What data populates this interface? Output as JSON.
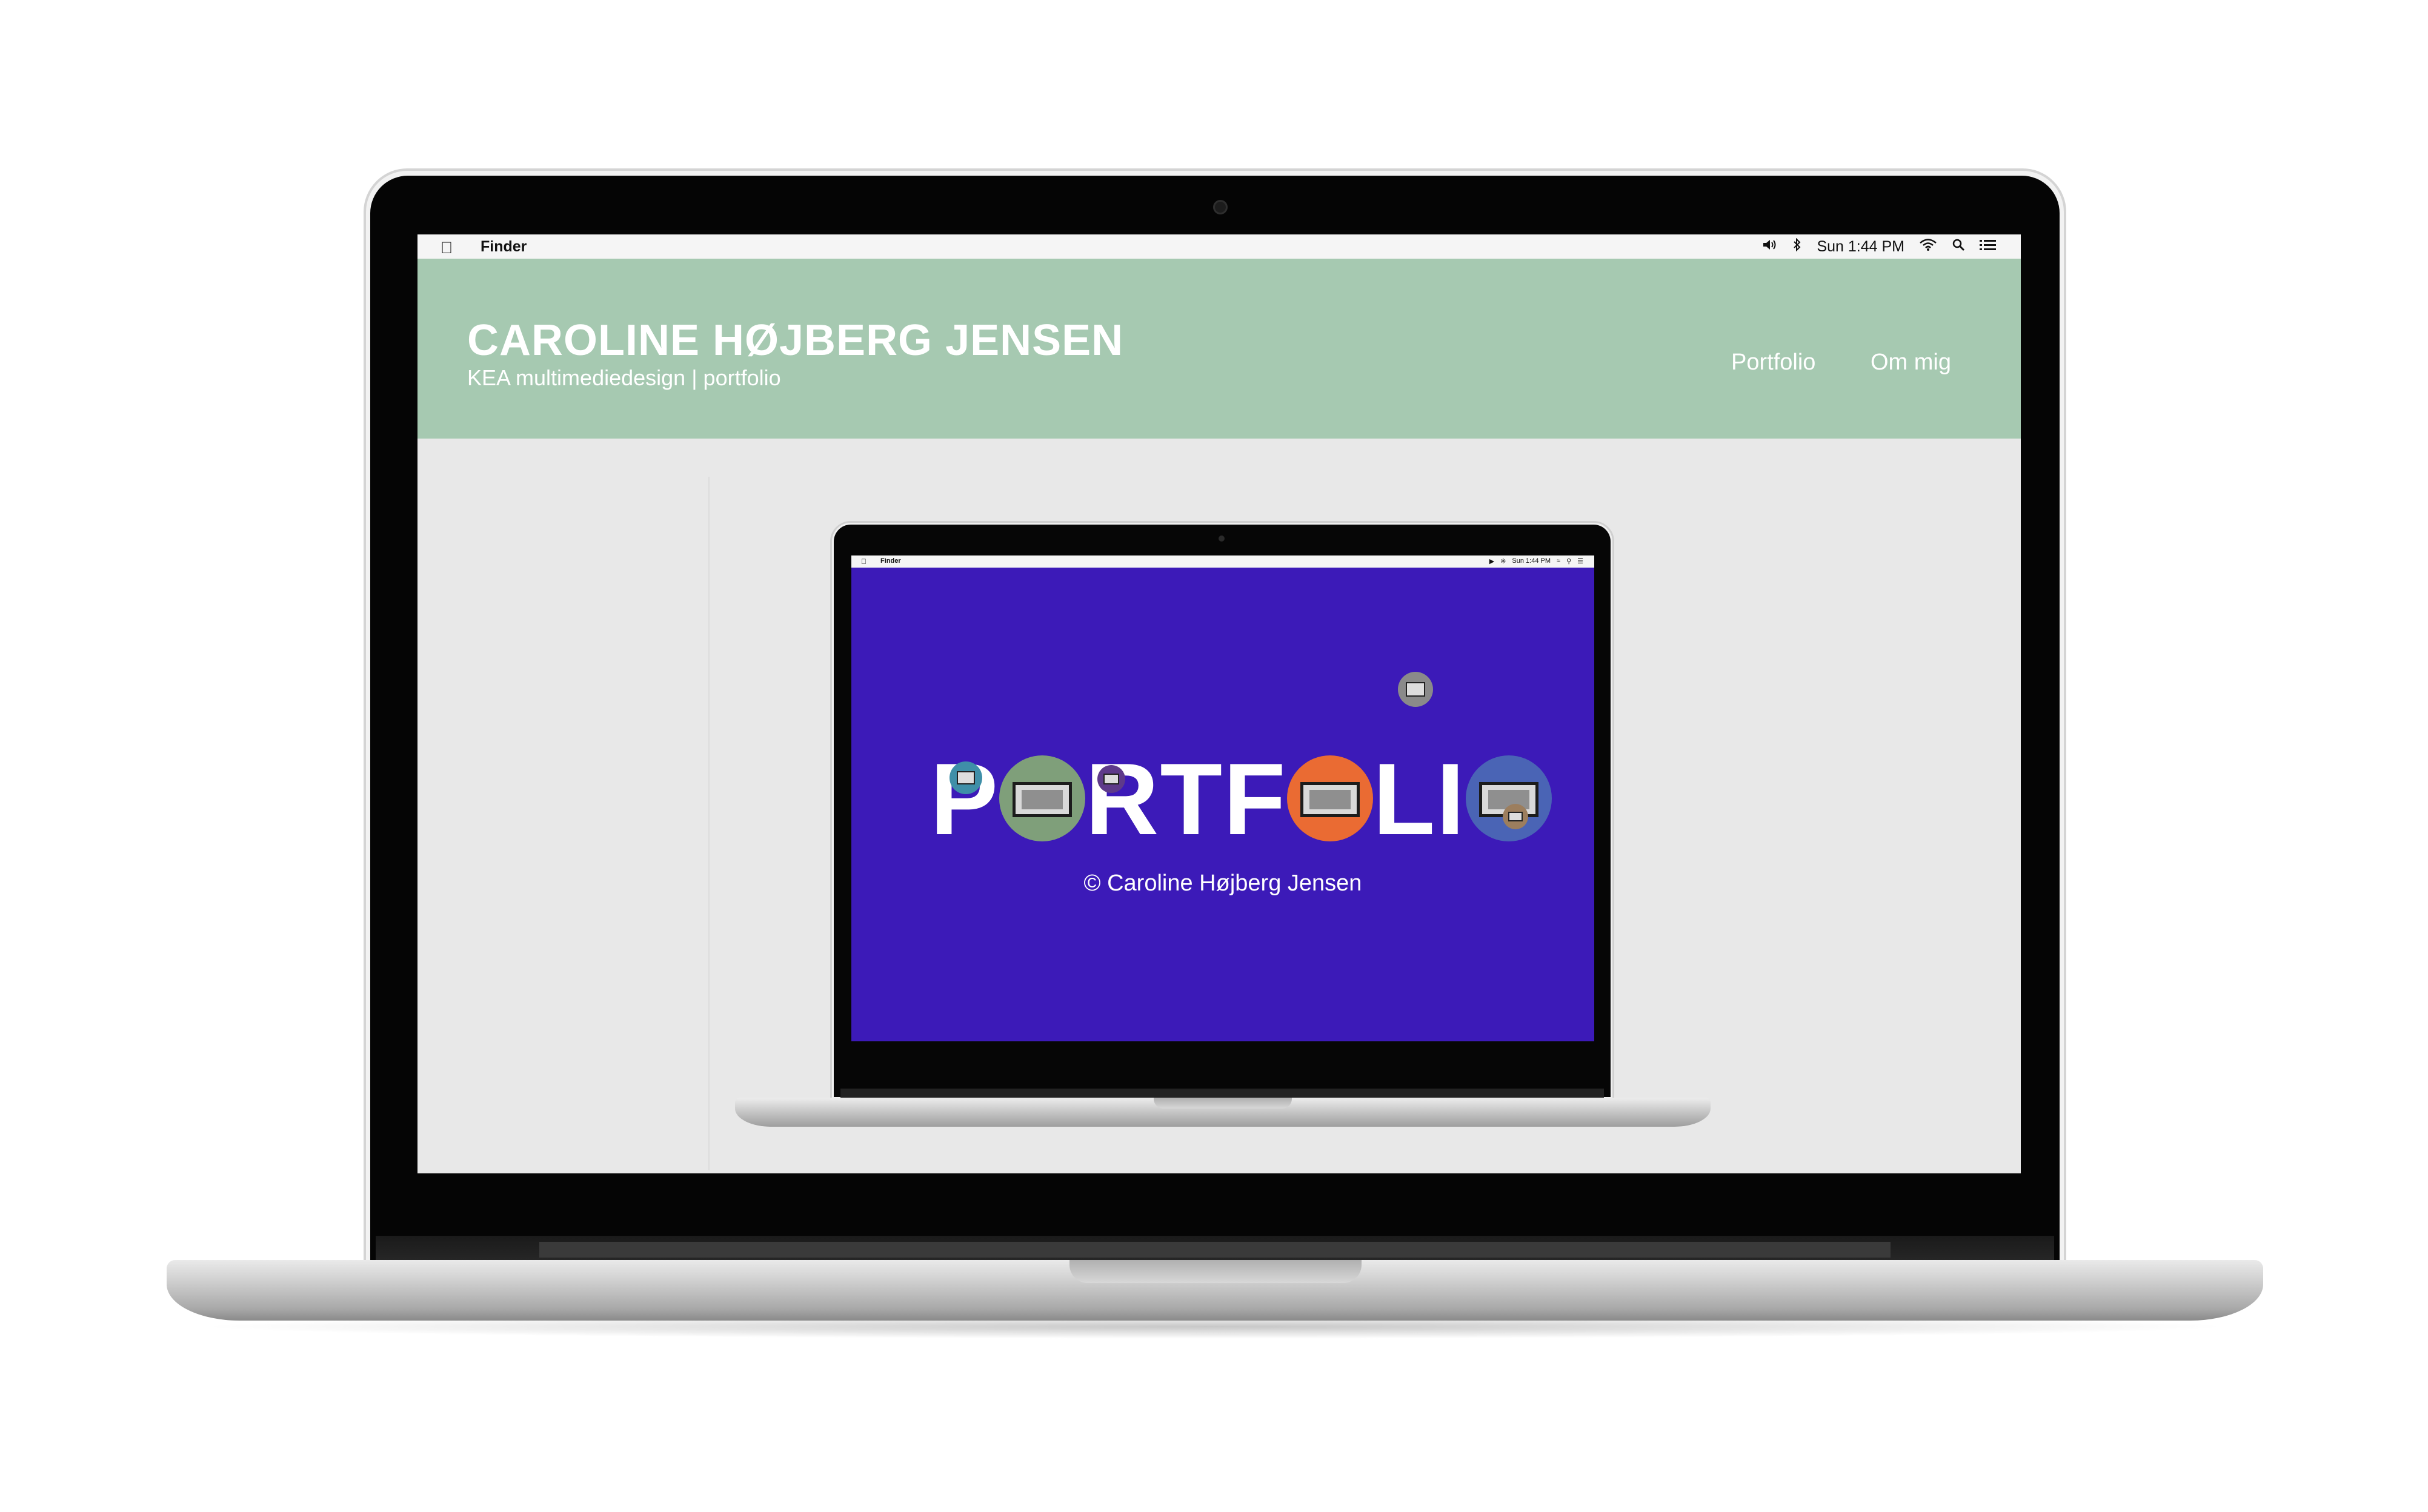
{
  "menubar": {
    "app_name": "Finder",
    "clock": "Sun 1:44 PM"
  },
  "site": {
    "title": "CAROLINE HØJBERG JENSEN",
    "subtitle": "KEA multimediedesign | portfolio",
    "nav": [
      "Portfolio",
      "Om mig"
    ]
  },
  "inner_screen": {
    "menubar": {
      "app_name": "Finder",
      "clock": "Sun 1:44 PM"
    },
    "portfolio_letters": [
      "P",
      "R",
      "T",
      "F",
      "L",
      "I"
    ],
    "copyright": "© Caroline Højberg Jensen"
  },
  "colors": {
    "header_bg": "#a6c9b1",
    "page_bg": "#e8e8e8",
    "inner_screen_bg": "#3c1ab8",
    "circle_green": "#7f9f7a",
    "circle_orange": "#ea6b33",
    "circle_blue": "#4a64b5",
    "dot_teal": "#3f8fa8",
    "dot_purple": "#5e3a8a",
    "dot_grey": "#8a8a8a",
    "dot_tan": "#9c7e5e"
  },
  "icons": [
    "apple-icon",
    "volume-icon",
    "bluetooth-icon",
    "wifi-icon",
    "search-icon",
    "list-icon"
  ]
}
